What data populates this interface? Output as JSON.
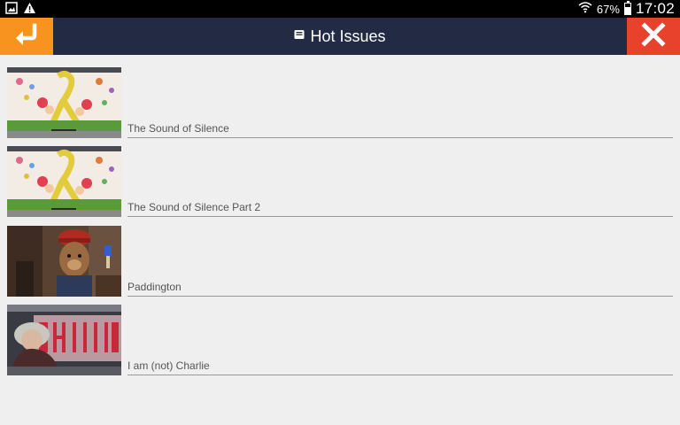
{
  "status_bar": {
    "battery_percent": "67%",
    "battery_level": 0.67,
    "time": "17:02",
    "left_icons": [
      "image-icon",
      "warning-icon"
    ],
    "right_icons": [
      "wifi-icon",
      "battery-icon"
    ]
  },
  "header": {
    "title": "Hot Issues",
    "title_icon": "inbox-icon",
    "back_icon": "back-arrow-icon",
    "close_icon": "close-icon",
    "colors": {
      "bar": "#232a44",
      "back": "#f7931e",
      "close": "#e8412c"
    }
  },
  "items": [
    {
      "label": "The Sound of Silence",
      "thumb": "ribbon-mural"
    },
    {
      "label": "The Sound of Silence Part 2",
      "thumb": "ribbon-mural"
    },
    {
      "label": "Paddington",
      "thumb": "paddington-bear"
    },
    {
      "label": "I am (not) Charlie",
      "thumb": "charlie-sign"
    }
  ]
}
